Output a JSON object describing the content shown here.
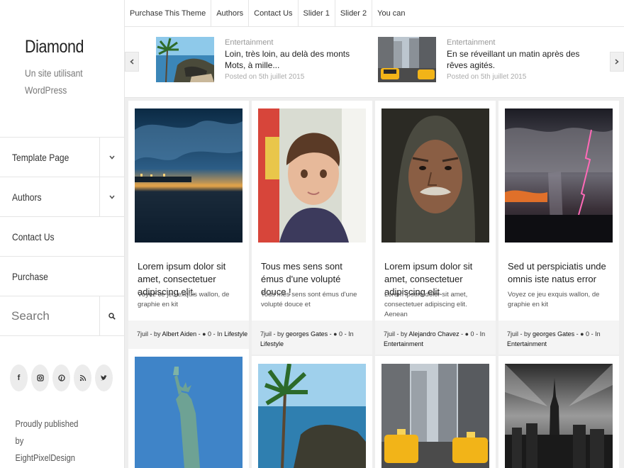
{
  "site": {
    "title": "Diamond",
    "description": "Un site utilisant WordPress",
    "published_by": "Proudly published by EightPixelDesign"
  },
  "sidebar_menu": [
    {
      "label": "Template Page",
      "has_submenu": true
    },
    {
      "label": "Authors",
      "has_submenu": true
    },
    {
      "label": "Contact Us",
      "has_submenu": false
    },
    {
      "label": "Purchase",
      "has_submenu": false
    }
  ],
  "search": {
    "placeholder": "Search",
    "icon": "search-icon"
  },
  "social_icons": [
    "facebook-icon",
    "instagram-icon",
    "pinterest-icon",
    "rss-icon",
    "twitter-icon"
  ],
  "top_menu": [
    "Purchase This Theme",
    "Authors",
    "Contact Us",
    "Slider 1",
    "Slider 2",
    "You can"
  ],
  "slider": [
    {
      "category": "Entertainment",
      "title": "Loin, très loin, au delà des monts Mots, à mille...",
      "date": "Posted on 5th juillet 2015",
      "image": "coast-cliff"
    },
    {
      "category": "Entertainment",
      "title": "En se réveillant un matin après des rêves agités.",
      "date": "Posted on 5th juillet 2015",
      "image": "taxi-street"
    }
  ],
  "posts": [
    {
      "title": "Lorem ipsum dolor sit amet, consectetuer adipiscing elit.",
      "excerpt": "Voyez ce jeu exquis wallon, de graphie en kit",
      "date": "7juil",
      "author": "Albert Aiden",
      "comments": "0",
      "category": "Lifestyle",
      "image": "night-harbour"
    },
    {
      "title": "Tous mes sens sont émus d'une volupté douce !",
      "excerpt": "Tous mes sens sont émus d'une volupté douce et",
      "date": "7juil",
      "author": "georges Gates",
      "comments": "0",
      "category": "Lifestyle",
      "image": "child-portrait"
    },
    {
      "title": "Lorem ipsum dolor sit amet, consectetuer adipiscing elit.",
      "excerpt": "Lorem ipsum dolor sit amet, consectetuer adipiscing elit. Aenean",
      "date": "7juil",
      "author": "Alejandro Chavez",
      "comments": "0",
      "category": "Entertainment",
      "image": "old-man-portrait"
    },
    {
      "title": "Sed ut perspiciatis unde omnis iste natus error",
      "excerpt": "Voyez ce jeu exquis wallon, de graphie en kit",
      "date": "7juil",
      "author": "georges Gates",
      "comments": "0",
      "category": "Entertainment",
      "image": "lightning-storm"
    }
  ],
  "posts_row2_images": [
    "statue-of-liberty",
    "coast-cliff",
    "taxi-street",
    "city-skyline-bw"
  ],
  "meta_words": {
    "by": "by",
    "in": "In"
  }
}
